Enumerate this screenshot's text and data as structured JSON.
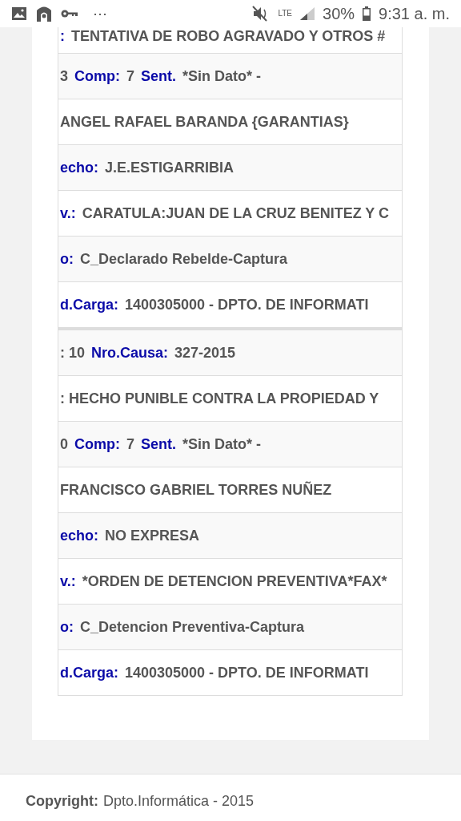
{
  "status_bar": {
    "more": "⋯",
    "network": "LTE",
    "battery": "30%",
    "time": "9:31 a. m."
  },
  "records": [
    {
      "lines": [
        {
          "parts": [
            {
              "kind": "label",
              "text": ":"
            },
            {
              "kind": "value",
              "text": "TENTATIVA DE ROBO AGRAVADO Y OTROS #"
            }
          ]
        },
        {
          "parts": [
            {
              "kind": "value",
              "text": "3"
            },
            {
              "kind": "label",
              "text": "Comp:"
            },
            {
              "kind": "value",
              "text": "7"
            },
            {
              "kind": "label",
              "text": "Sent."
            },
            {
              "kind": "plain",
              "text": "*Sin Dato* -"
            }
          ]
        },
        {
          "parts": [
            {
              "kind": "value",
              "text": "ANGEL RAFAEL BARANDA {GARANTIAS}"
            }
          ]
        },
        {
          "parts": [
            {
              "kind": "label",
              "text": "echo:"
            },
            {
              "kind": "value",
              "text": "J.E.ESTIGARRIBIA"
            }
          ]
        },
        {
          "parts": [
            {
              "kind": "label",
              "text": "v.:"
            },
            {
              "kind": "value",
              "text": "CARATULA:JUAN DE LA CRUZ BENITEZ Y C"
            }
          ]
        },
        {
          "parts": [
            {
              "kind": "label",
              "text": "o:"
            },
            {
              "kind": "value",
              "text": "C_Declarado Rebelde-Captura"
            }
          ]
        },
        {
          "parts": [
            {
              "kind": "label",
              "text": "d.Carga:"
            },
            {
              "kind": "value",
              "text": "1400305000 - DPTO. DE INFORMATI"
            }
          ]
        }
      ]
    },
    {
      "lines": [
        {
          "parts": [
            {
              "kind": "plain",
              "text": ": 10"
            },
            {
              "kind": "label",
              "text": "Nro.Causa:"
            },
            {
              "kind": "value",
              "text": "327-2015"
            }
          ]
        },
        {
          "parts": [
            {
              "kind": "plain",
              "text": ": HECHO PUNIBLE CONTRA LA PROPIEDAD Y"
            }
          ]
        },
        {
          "parts": [
            {
              "kind": "value",
              "text": "0"
            },
            {
              "kind": "label",
              "text": "Comp:"
            },
            {
              "kind": "value",
              "text": "7"
            },
            {
              "kind": "label",
              "text": "Sent."
            },
            {
              "kind": "plain",
              "text": "*Sin Dato* -"
            }
          ]
        },
        {
          "parts": [
            {
              "kind": "value",
              "text": "FRANCISCO GABRIEL TORRES NUÑEZ"
            }
          ]
        },
        {
          "parts": [
            {
              "kind": "label",
              "text": "echo:"
            },
            {
              "kind": "value",
              "text": "NO EXPRESA"
            }
          ]
        },
        {
          "parts": [
            {
              "kind": "label",
              "text": "v.:"
            },
            {
              "kind": "value",
              "text": "*ORDEN DE DETENCION PREVENTIVA*FAX*"
            }
          ]
        },
        {
          "parts": [
            {
              "kind": "label",
              "text": "o:"
            },
            {
              "kind": "value",
              "text": "C_Detencion Preventiva-Captura"
            }
          ]
        },
        {
          "parts": [
            {
              "kind": "label",
              "text": "d.Carga:"
            },
            {
              "kind": "value",
              "text": "1400305000 - DPTO. DE INFORMATI"
            }
          ]
        }
      ]
    }
  ],
  "footer": {
    "label": "Copyright:",
    "text": "Dpto.Informática - 2015"
  }
}
